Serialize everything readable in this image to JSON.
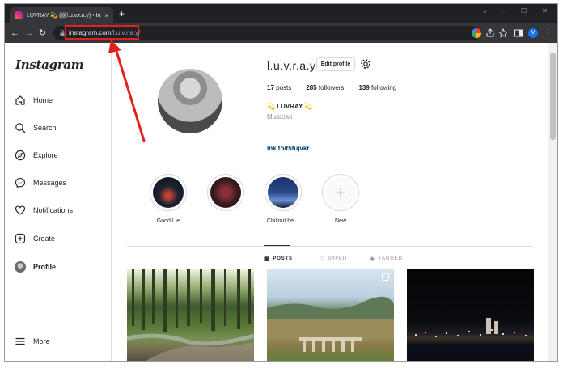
{
  "browser": {
    "tab_title": "LUVRAY 💫 (@l.u.v.r.a.y) • Insta…",
    "tab_close": "×",
    "new_tab": "+",
    "url_host": "instagram.com",
    "url_path": "/l.u.v.r.a.y/",
    "profile_initial": "V",
    "window_controls": {
      "minimize": "—",
      "maximize": "☐",
      "close": "✕"
    },
    "nav": {
      "back": "←",
      "forward": "→",
      "reload": "↻"
    },
    "menu": "⋮"
  },
  "sidebar": {
    "logo": "Instagram",
    "items": [
      {
        "label": "Home",
        "icon": "home-icon"
      },
      {
        "label": "Search",
        "icon": "search-icon"
      },
      {
        "label": "Explore",
        "icon": "compass-icon"
      },
      {
        "label": "Messages",
        "icon": "messenger-icon"
      },
      {
        "label": "Notifications",
        "icon": "heart-icon"
      },
      {
        "label": "Create",
        "icon": "plus-square-icon"
      },
      {
        "label": "Profile",
        "icon": "profile-avatar"
      }
    ],
    "more": "More"
  },
  "profile": {
    "username": "l.u.v.r.a.y",
    "edit_button": "Edit profile",
    "posts_count": "17",
    "posts_label": "posts",
    "followers_count": "285",
    "followers_label": "followers",
    "following_count": "139",
    "following_label": "following",
    "full_name": "💫 LUVRAY 💫",
    "category": "Musician",
    "link": "lnk.to/t5fujvkr"
  },
  "highlights": [
    {
      "label": "Good Lie",
      "color": "#1c2230"
    },
    {
      "label": "",
      "color": "#3a1a1f"
    },
    {
      "label": "Chillout be…",
      "color": "#2a4a8a"
    }
  ],
  "new_highlight": {
    "label": "New",
    "symbol": "+"
  },
  "tabs": [
    {
      "label": "POSTS",
      "icon": "▦",
      "active": true
    },
    {
      "label": "SAVED",
      "icon": "⚐",
      "active": false
    },
    {
      "label": "TAGGED",
      "icon": "◉",
      "active": false
    }
  ],
  "colors": {
    "annotation_red": "#e3211c",
    "link_blue": "#00376b",
    "chrome_dark": "#202124"
  }
}
